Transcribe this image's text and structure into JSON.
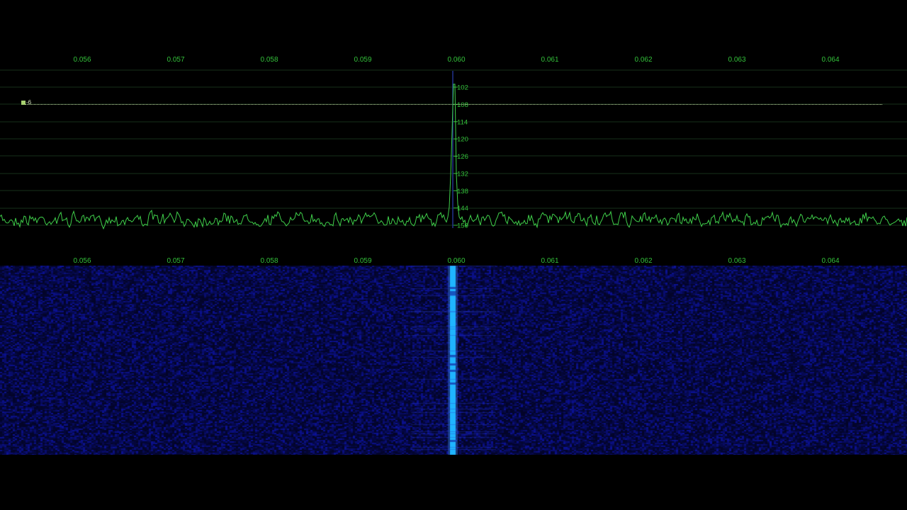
{
  "colors": {
    "background": "#000000",
    "axis_label": "#33c13a",
    "trace": "#3fcf4a",
    "grid": "#16301a",
    "level_line": "#bfd5a0",
    "waterfall_noise": "#0a1a7a",
    "waterfall_signal": "#1fb4ff",
    "center_marker": "#2a3fb0"
  },
  "top_axis": {
    "ticks": [
      "0.056",
      "0.057",
      "0.058",
      "0.059",
      "0.060",
      "0.061",
      "0.062",
      "0.063",
      "0.064"
    ]
  },
  "waterfall_axis": {
    "ticks": [
      "0.056",
      "0.057",
      "0.058",
      "0.059",
      "0.060",
      "0.061",
      "0.062",
      "0.063",
      "0.064"
    ]
  },
  "db_scale": {
    "ticks": [
      "102",
      "108",
      "114",
      "120",
      "126",
      "132",
      "138",
      "144",
      "150"
    ]
  },
  "level_marker": {
    "label": "-6",
    "icon": "square-marker-icon"
  },
  "chart_data": {
    "type": "line",
    "xlim": [
      0.0554,
      0.0647
    ],
    "ylim": [
      -156,
      -96
    ],
    "noise_floor_db": -148,
    "peak": {
      "x": 0.05997,
      "y": -101
    },
    "series": [
      {
        "values_description_free": true,
        "x": [
          0.0554,
          0.0599,
          0.05997,
          0.06,
          0.0647
        ],
        "y": [
          -148,
          -148,
          -101,
          -148,
          -148
        ]
      }
    ]
  }
}
